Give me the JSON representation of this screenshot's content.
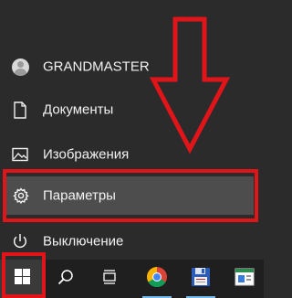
{
  "user": {
    "name": "GRANDMASTER"
  },
  "menu": {
    "documents_label": "Документы",
    "pictures_label": "Изображения",
    "settings_label": "Параметры",
    "power_label": "Выключение"
  },
  "colors": {
    "menu_bg": "#2b2b2b",
    "taskbar_bg": "#1f1f1f",
    "highlight_bg": "#4d4d4d",
    "annotation_red": "#e01419",
    "accent": "#76b9ed"
  },
  "icons": {
    "avatar": "user-avatar-icon",
    "documents": "document-icon",
    "pictures": "picture-icon",
    "settings": "gear-icon",
    "power": "power-icon",
    "start": "windows-logo-icon",
    "search": "search-icon",
    "task_view": "task-view-icon",
    "chrome": "chrome-icon",
    "save": "floppy-disk-icon",
    "app": "window-app-icon"
  }
}
